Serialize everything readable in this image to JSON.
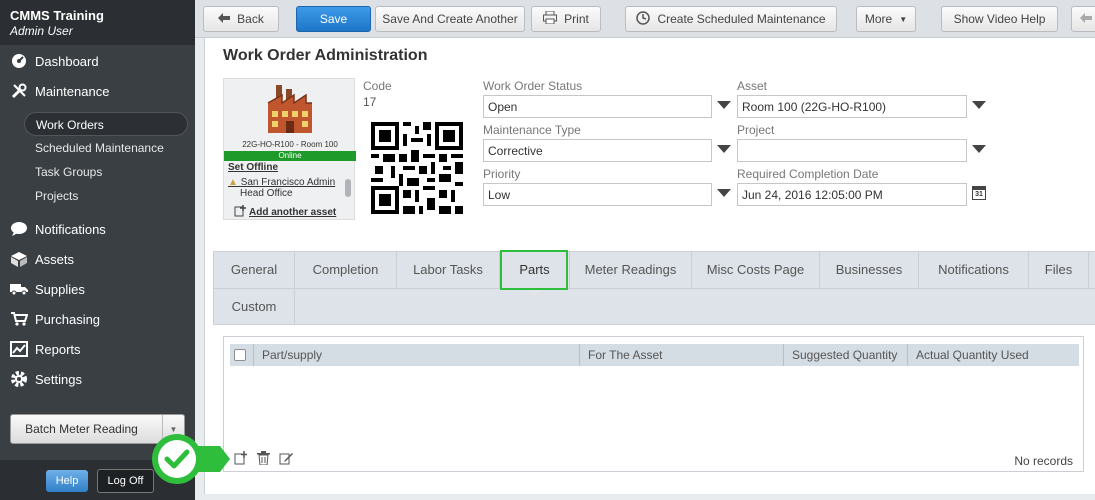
{
  "app": {
    "title": "CMMS Training",
    "user": "Admin User"
  },
  "sidebar": {
    "items": [
      {
        "label": "Dashboard",
        "icon": "dashboard-icon"
      },
      {
        "label": "Maintenance",
        "icon": "tools-icon"
      },
      {
        "label": "Notifications",
        "icon": "chat-bubble-icon"
      },
      {
        "label": "Assets",
        "icon": "boxes-icon"
      },
      {
        "label": "Supplies",
        "icon": "truck-icon"
      },
      {
        "label": "Purchasing",
        "icon": "cart-icon"
      },
      {
        "label": "Reports",
        "icon": "chart-icon"
      },
      {
        "label": "Settings",
        "icon": "gear-icon"
      }
    ],
    "maintenance_sub": [
      "Work Orders",
      "Scheduled Maintenance",
      "Task Groups",
      "Projects"
    ],
    "batch_button": "Batch Meter Reading",
    "help": "Help",
    "logoff": "Log Off"
  },
  "toolbar": {
    "back": "Back",
    "save": "Save",
    "save_create": "Save And Create Another",
    "print": "Print",
    "create_scheduled": "Create Scheduled Maintenance",
    "more": "More",
    "video_help": "Show Video Help"
  },
  "page": {
    "title": "Work Order Administration"
  },
  "asset_card": {
    "caption": "22G-HO-R100 - Room 100",
    "status": "Online",
    "set_offline": "Set Offline",
    "location": "San Francisco Admin",
    "sublocation": "Head Office",
    "add_asset": "Add another asset"
  },
  "fields": {
    "code_label": "Code",
    "code_value": "17",
    "status_label": "Work Order Status",
    "status_value": "Open",
    "asset_label": "Asset",
    "asset_value": "Room 100 (22G-HO-R100)",
    "mtype_label": "Maintenance Type",
    "mtype_value": "Corrective",
    "project_label": "Project",
    "project_value": "",
    "priority_label": "Priority",
    "priority_value": "Low",
    "rcd_label": "Required Completion Date",
    "rcd_value": "Jun 24, 2016 12:05:00 PM",
    "calendar_day": "31"
  },
  "tabs": [
    "General",
    "Completion",
    "Labor Tasks",
    "Parts",
    "Meter Readings",
    "Misc Costs Page",
    "Businesses",
    "Notifications",
    "Files",
    "Custom"
  ],
  "active_tab": "Parts",
  "grid": {
    "columns": [
      "Part/supply",
      "For The Asset",
      "Suggested Quantity",
      "Actual Quantity Used"
    ],
    "empty_text": "No records"
  },
  "colors": {
    "accent": "#1f75c7",
    "highlight": "#2fbd3c",
    "online": "#1d9a2a",
    "sidebar": "#3a3f44"
  }
}
